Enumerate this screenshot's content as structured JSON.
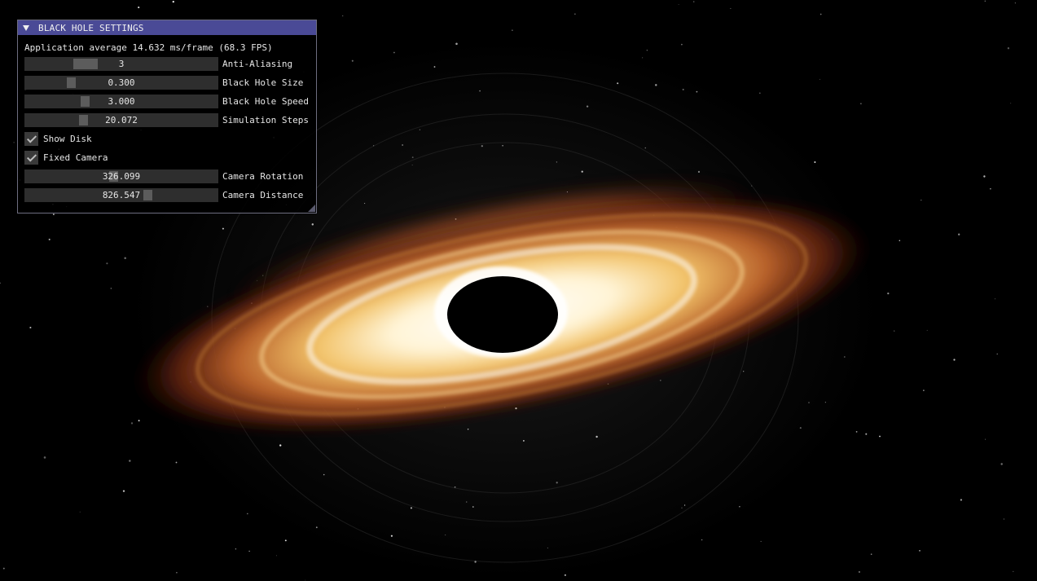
{
  "window": {
    "title": "BLACK HOLE SETTINGS",
    "fps_text": "Application average 14.632 ms/frame (68.3 FPS)"
  },
  "sliders": [
    {
      "label": "Anti-Aliasing",
      "value": "3",
      "grab_fraction": 0.27
    },
    {
      "label": "Black Hole Size",
      "value": "0.300",
      "grab_fraction": 0.23
    },
    {
      "label": "Black Hole Speed",
      "value": "3.000",
      "grab_fraction": 0.31
    },
    {
      "label": "Simulation Steps",
      "value": "20.072",
      "grab_fraction": 0.3
    }
  ],
  "checkboxes": [
    {
      "label": "Show Disk",
      "checked": true
    },
    {
      "label": "Fixed Camera",
      "checked": true
    }
  ],
  "camera_sliders": [
    {
      "label": "Camera Rotation",
      "value": "326.099",
      "grab_fraction": 0.46
    },
    {
      "label": "Camera Distance",
      "value": "826.547",
      "grab_fraction": 0.65
    }
  ],
  "colors": {
    "titlebar": "#4a4a96",
    "panel_bg": "#000000",
    "slider_bg": "#2e2e2e",
    "grab": "#5c5c5c",
    "disk_inner": "#ffffff",
    "disk_mid": "#f2c36a",
    "disk_outer": "#7a2e12"
  }
}
